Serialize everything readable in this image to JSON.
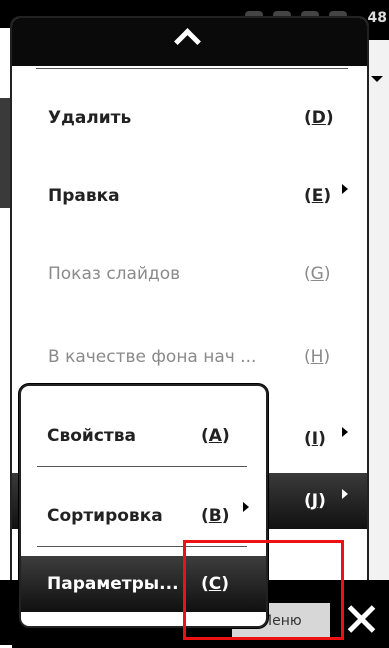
{
  "status_bar": {
    "time": "48"
  },
  "menu": {
    "header_icon": "chevron-up-icon",
    "items": [
      {
        "label": "Удалить",
        "accel_open": "(",
        "accel_key": "D",
        "accel_close": ")",
        "enabled": true,
        "has_submenu": false
      },
      {
        "label": "Правка",
        "accel_open": "(",
        "accel_key": "E",
        "accel_close": ")",
        "enabled": true,
        "has_submenu": true
      },
      {
        "label": "Показ слайдов",
        "accel_open": "(",
        "accel_key": "G",
        "accel_close": ")",
        "enabled": false,
        "has_submenu": false
      },
      {
        "label": "В качестве фона нач ...",
        "accel_open": "(",
        "accel_key": "H",
        "accel_close": ")",
        "enabled": false,
        "has_submenu": false
      },
      {
        "label": "",
        "accel_open": "(",
        "accel_key": "I",
        "accel_close": ")",
        "enabled": true,
        "has_submenu": true
      },
      {
        "label": "",
        "accel_open": "(",
        "accel_key": "J",
        "accel_close": ")",
        "enabled": true,
        "has_submenu": true,
        "selected": true
      }
    ]
  },
  "submenu": {
    "items": [
      {
        "label": "Свойства",
        "accel_open": "(",
        "accel_key": "A",
        "accel_close": ")",
        "has_submenu": false
      },
      {
        "label": "Сортировка",
        "accel_open": "(",
        "accel_key": "B",
        "accel_close": ")",
        "has_submenu": true
      },
      {
        "label": "Параметры...",
        "accel_open": "(",
        "accel_key": "C",
        "accel_close": ")",
        "has_submenu": false,
        "selected": true
      }
    ]
  },
  "softkeys": {
    "menu_label": "Меню",
    "close_icon": "close-icon"
  },
  "colors": {
    "highlight": "#e11",
    "selected_bg": "#1a1a1a",
    "disabled_text": "#8a8a8a"
  }
}
